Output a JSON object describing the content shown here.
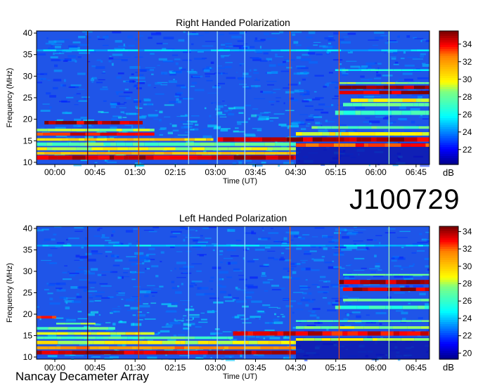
{
  "source_id": "J100729",
  "footer": "Nancay Decameter Array",
  "chart_data": [
    {
      "type": "heatmap",
      "title": "Right Handed Polarization",
      "xlabel": "Time (UT)",
      "ylabel": "Frequency (MHz)",
      "x_ticks": [
        "00:00",
        "00:45",
        "01:30",
        "02:15",
        "03:00",
        "03:45",
        "04:30",
        "05:15",
        "06:00",
        "06:45"
      ],
      "y_ticks": [
        10,
        15,
        20,
        25,
        30,
        35,
        40
      ],
      "ylim": [
        9.5,
        40.5
      ],
      "colorbar": {
        "label": "dB",
        "ticks": [
          22,
          24,
          26,
          28,
          30,
          32,
          34
        ],
        "range": [
          20.3,
          35.5
        ]
      },
      "colormap": [
        "#00008f",
        "#0000ff",
        "#0080ff",
        "#00ffff",
        "#80ff80",
        "#ffff00",
        "#ff8000",
        "#ff0000",
        "#800000"
      ]
    },
    {
      "type": "heatmap",
      "title": "Left Handed Polarization",
      "xlabel": "Time (UT)",
      "ylabel": "Frequency (MHz)",
      "x_ticks": [
        "00:00",
        "00:45",
        "01:30",
        "02:15",
        "03:00",
        "03:45",
        "04:30",
        "05:15",
        "06:00",
        "06:45"
      ],
      "y_ticks": [
        10,
        15,
        20,
        25,
        30,
        35,
        40
      ],
      "ylim": [
        9.5,
        40.5
      ],
      "colorbar": {
        "label": "dB",
        "ticks": [
          20,
          22,
          24,
          26,
          28,
          30,
          32,
          34
        ],
        "range": [
          19.3,
          34.6
        ]
      },
      "colormap": [
        "#00008f",
        "#0000ff",
        "#0080ff",
        "#00ffff",
        "#80ff80",
        "#ffff00",
        "#ff8000",
        "#ff0000",
        "#800000"
      ]
    }
  ]
}
